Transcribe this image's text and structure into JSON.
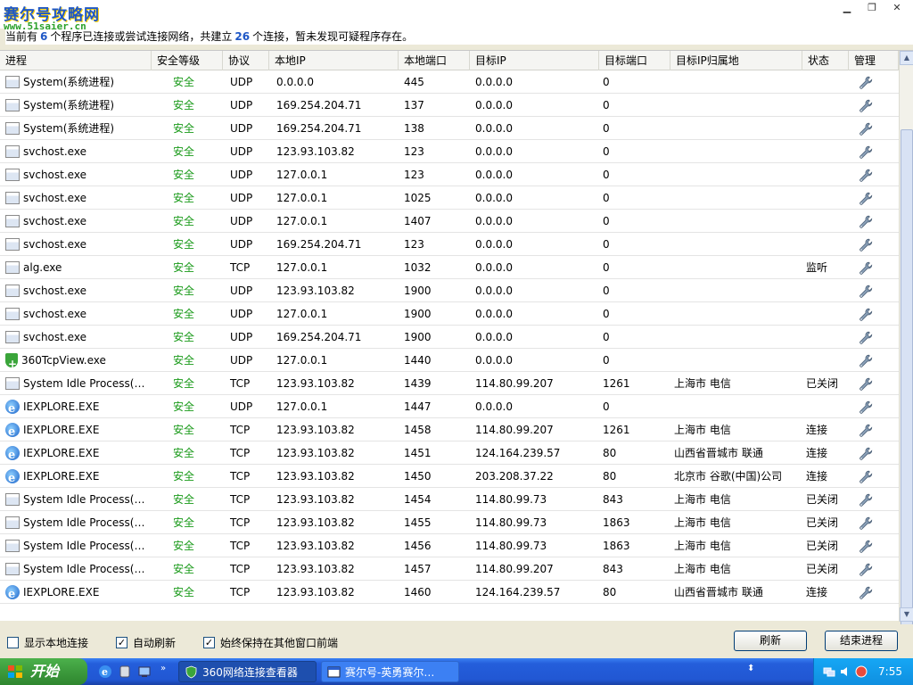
{
  "watermark": {
    "logo": "赛尔号攻略网",
    "url": "www.51saier.cn"
  },
  "summary": {
    "prefix": "当前有",
    "processes": "6",
    "middle": "个程序已连接或尝试连接网络，共建立",
    "connections": "26",
    "suffix": "个连接，暂未发现可疑程序存在。"
  },
  "columns": [
    "进程",
    "安全等级",
    "协议",
    "本地IP",
    "本地端口",
    "目标IP",
    "目标端口",
    "目标IP归属地",
    "状态",
    "管理"
  ],
  "rows": [
    {
      "icon": "exe",
      "process": "System(系统进程)",
      "level": "安全",
      "protocol": "UDP",
      "local_ip": "0.0.0.0",
      "local_port": "445",
      "remote_ip": "0.0.0.0",
      "remote_port": "0",
      "location": "",
      "state": ""
    },
    {
      "icon": "exe",
      "process": "System(系统进程)",
      "level": "安全",
      "protocol": "UDP",
      "local_ip": "169.254.204.71",
      "local_port": "137",
      "remote_ip": "0.0.0.0",
      "remote_port": "0",
      "location": "",
      "state": ""
    },
    {
      "icon": "exe",
      "process": "System(系统进程)",
      "level": "安全",
      "protocol": "UDP",
      "local_ip": "169.254.204.71",
      "local_port": "138",
      "remote_ip": "0.0.0.0",
      "remote_port": "0",
      "location": "",
      "state": ""
    },
    {
      "icon": "exe",
      "process": "svchost.exe",
      "level": "安全",
      "protocol": "UDP",
      "local_ip": "123.93.103.82",
      "local_port": "123",
      "remote_ip": "0.0.0.0",
      "remote_port": "0",
      "location": "",
      "state": ""
    },
    {
      "icon": "exe",
      "process": "svchost.exe",
      "level": "安全",
      "protocol": "UDP",
      "local_ip": "127.0.0.1",
      "local_port": "123",
      "remote_ip": "0.0.0.0",
      "remote_port": "0",
      "location": "",
      "state": ""
    },
    {
      "icon": "exe",
      "process": "svchost.exe",
      "level": "安全",
      "protocol": "UDP",
      "local_ip": "127.0.0.1",
      "local_port": "1025",
      "remote_ip": "0.0.0.0",
      "remote_port": "0",
      "location": "",
      "state": ""
    },
    {
      "icon": "exe",
      "process": "svchost.exe",
      "level": "安全",
      "protocol": "UDP",
      "local_ip": "127.0.0.1",
      "local_port": "1407",
      "remote_ip": "0.0.0.0",
      "remote_port": "0",
      "location": "",
      "state": ""
    },
    {
      "icon": "exe",
      "process": "svchost.exe",
      "level": "安全",
      "protocol": "UDP",
      "local_ip": "169.254.204.71",
      "local_port": "123",
      "remote_ip": "0.0.0.0",
      "remote_port": "0",
      "location": "",
      "state": ""
    },
    {
      "icon": "exe",
      "process": "alg.exe",
      "level": "安全",
      "protocol": "TCP",
      "local_ip": "127.0.0.1",
      "local_port": "1032",
      "remote_ip": "0.0.0.0",
      "remote_port": "0",
      "location": "",
      "state": "监听"
    },
    {
      "icon": "exe",
      "process": "svchost.exe",
      "level": "安全",
      "protocol": "UDP",
      "local_ip": "123.93.103.82",
      "local_port": "1900",
      "remote_ip": "0.0.0.0",
      "remote_port": "0",
      "location": "",
      "state": ""
    },
    {
      "icon": "exe",
      "process": "svchost.exe",
      "level": "安全",
      "protocol": "UDP",
      "local_ip": "127.0.0.1",
      "local_port": "1900",
      "remote_ip": "0.0.0.0",
      "remote_port": "0",
      "location": "",
      "state": ""
    },
    {
      "icon": "exe",
      "process": "svchost.exe",
      "level": "安全",
      "protocol": "UDP",
      "local_ip": "169.254.204.71",
      "local_port": "1900",
      "remote_ip": "0.0.0.0",
      "remote_port": "0",
      "location": "",
      "state": ""
    },
    {
      "icon": "shield",
      "process": "360TcpView.exe",
      "level": "安全",
      "protocol": "UDP",
      "local_ip": "127.0.0.1",
      "local_port": "1440",
      "remote_ip": "0.0.0.0",
      "remote_port": "0",
      "location": "",
      "state": ""
    },
    {
      "icon": "exe",
      "process": "System Idle Process(…",
      "level": "安全",
      "protocol": "TCP",
      "local_ip": "123.93.103.82",
      "local_port": "1439",
      "remote_ip": "114.80.99.207",
      "remote_port": "1261",
      "location": "上海市  电信",
      "state": "已关闭"
    },
    {
      "icon": "ie",
      "process": "IEXPLORE.EXE",
      "level": "安全",
      "protocol": "UDP",
      "local_ip": "127.0.0.1",
      "local_port": "1447",
      "remote_ip": "0.0.0.0",
      "remote_port": "0",
      "location": "",
      "state": ""
    },
    {
      "icon": "ie",
      "process": "IEXPLORE.EXE",
      "level": "安全",
      "protocol": "TCP",
      "local_ip": "123.93.103.82",
      "local_port": "1458",
      "remote_ip": "114.80.99.207",
      "remote_port": "1261",
      "location": "上海市  电信",
      "state": "连接"
    },
    {
      "icon": "ie",
      "process": "IEXPLORE.EXE",
      "level": "安全",
      "protocol": "TCP",
      "local_ip": "123.93.103.82",
      "local_port": "1451",
      "remote_ip": "124.164.239.57",
      "remote_port": "80",
      "location": "山西省晋城市  联通",
      "state": "连接"
    },
    {
      "icon": "ie",
      "process": "IEXPLORE.EXE",
      "level": "安全",
      "protocol": "TCP",
      "local_ip": "123.93.103.82",
      "local_port": "1450",
      "remote_ip": "203.208.37.22",
      "remote_port": "80",
      "location": "北京市  谷歌(中国)公司",
      "state": "连接"
    },
    {
      "icon": "exe",
      "process": "System Idle Process(…",
      "level": "安全",
      "protocol": "TCP",
      "local_ip": "123.93.103.82",
      "local_port": "1454",
      "remote_ip": "114.80.99.73",
      "remote_port": "843",
      "location": "上海市  电信",
      "state": "已关闭"
    },
    {
      "icon": "exe",
      "process": "System Idle Process(…",
      "level": "安全",
      "protocol": "TCP",
      "local_ip": "123.93.103.82",
      "local_port": "1455",
      "remote_ip": "114.80.99.73",
      "remote_port": "1863",
      "location": "上海市  电信",
      "state": "已关闭"
    },
    {
      "icon": "exe",
      "process": "System Idle Process(…",
      "level": "安全",
      "protocol": "TCP",
      "local_ip": "123.93.103.82",
      "local_port": "1456",
      "remote_ip": "114.80.99.73",
      "remote_port": "1863",
      "location": "上海市  电信",
      "state": "已关闭"
    },
    {
      "icon": "exe",
      "process": "System Idle Process(…",
      "level": "安全",
      "protocol": "TCP",
      "local_ip": "123.93.103.82",
      "local_port": "1457",
      "remote_ip": "114.80.99.207",
      "remote_port": "843",
      "location": "上海市  电信",
      "state": "已关闭"
    },
    {
      "icon": "ie",
      "process": "IEXPLORE.EXE",
      "level": "安全",
      "protocol": "TCP",
      "local_ip": "123.93.103.82",
      "local_port": "1460",
      "remote_ip": "124.164.239.57",
      "remote_port": "80",
      "location": "山西省晋城市  联通",
      "state": "连接"
    }
  ],
  "options": {
    "show_local": {
      "label": "显示本地连接",
      "checked": false
    },
    "auto_refresh": {
      "label": "自动刷新",
      "checked": true
    },
    "always_on_top": {
      "label": "始终保持在其他窗口前端",
      "checked": true
    }
  },
  "buttons": {
    "refresh": "刷新",
    "end_process": "结束进程"
  },
  "taskbar": {
    "start_label": "开始",
    "tasks": [
      {
        "label": "360网络连接查看器",
        "active": true
      },
      {
        "label": "赛尔号-英勇赛尔…",
        "active": false
      }
    ],
    "clock": "7:55"
  },
  "colors": {
    "safe": "#1a9a1a",
    "accent": "#1e57c6",
    "taskbar": "#245edb",
    "start": "#3c9a3c"
  }
}
